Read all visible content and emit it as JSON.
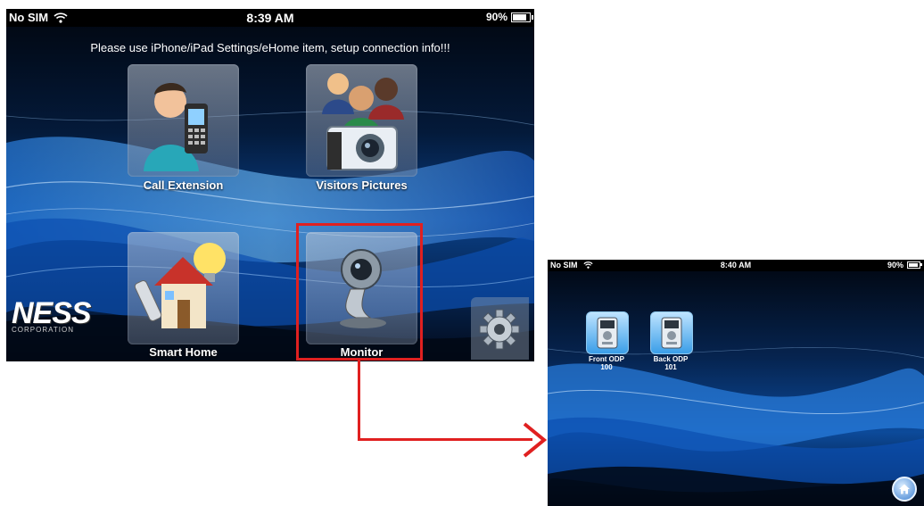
{
  "screen_a": {
    "status": {
      "carrier": "No SIM",
      "time": "8:39 AM",
      "battery": "90%"
    },
    "notice": "Please use iPhone/iPad Settings/eHome item, setup connection info!!!",
    "tiles": [
      {
        "label": "Call Extension",
        "icon": "person-phone-icon"
      },
      {
        "label": "Visitors Pictures",
        "icon": "visitors-camera-icon"
      },
      {
        "label": "Smart Home",
        "icon": "house-bulb-icon"
      },
      {
        "label": "Monitor",
        "icon": "webcam-icon"
      }
    ],
    "logo": {
      "mark": "NESS",
      "sub": "CORPORATION"
    },
    "settings_icon": "gear-icon"
  },
  "screen_b": {
    "status": {
      "carrier": "No SIM",
      "time": "8:40 AM",
      "battery": "90%"
    },
    "devices": [
      {
        "name": "Front ODP",
        "number": "100",
        "icon": "intercom-panel-icon"
      },
      {
        "name": "Back ODP",
        "number": "101",
        "icon": "intercom-panel-icon"
      }
    ],
    "home_icon": "home-icon"
  },
  "annotation": {
    "highlight_color": "#e02020"
  },
  "colors": {
    "background_dark": "#020a1a",
    "wave_blue": "#2a7fe0"
  }
}
